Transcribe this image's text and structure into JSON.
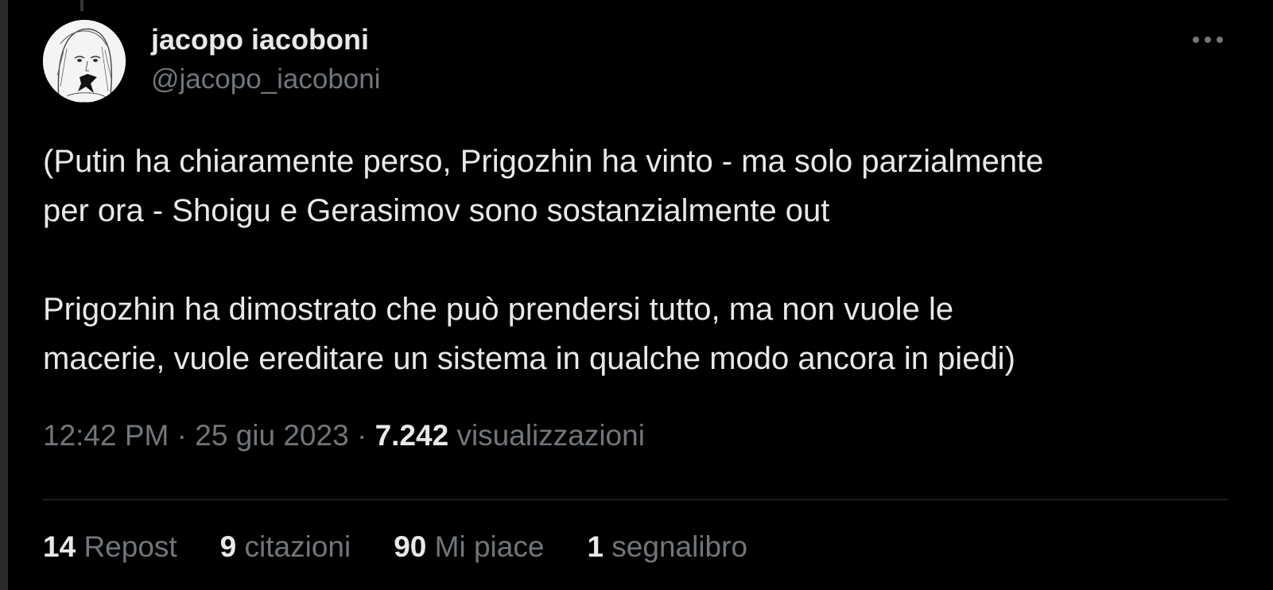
{
  "colors": {
    "background": "#000000",
    "text_primary": "#e7e9ea",
    "text_secondary": "#71767b",
    "divider": "#2f3336"
  },
  "author": {
    "display_name": "jacopo iacoboni",
    "handle": "@jacopo_iacoboni",
    "avatar_icon": "sketch-portrait-avatar"
  },
  "more_icon": "more-horizontal-icon",
  "tweet": {
    "text": "(Putin ha chiaramente perso, Prigozhin ha vinto - ma solo parzialmente\nper ora - Shoigu e Gerasimov sono sostanzialmente out\n\nPrigozhin ha dimostrato che può prendersi tutto, ma non vuole le\nmacerie, vuole ereditare un sistema in qualche modo ancora in piedi)"
  },
  "meta": {
    "time": "12:42 PM",
    "separator": "·",
    "date": "25 giu 2023",
    "views_count": "7.242",
    "views_label": "visualizzazioni"
  },
  "stats": [
    {
      "count": "14",
      "label": "Repost"
    },
    {
      "count": "9",
      "label": "citazioni"
    },
    {
      "count": "90",
      "label": "Mi piace"
    },
    {
      "count": "1",
      "label": "segnalibro"
    }
  ]
}
